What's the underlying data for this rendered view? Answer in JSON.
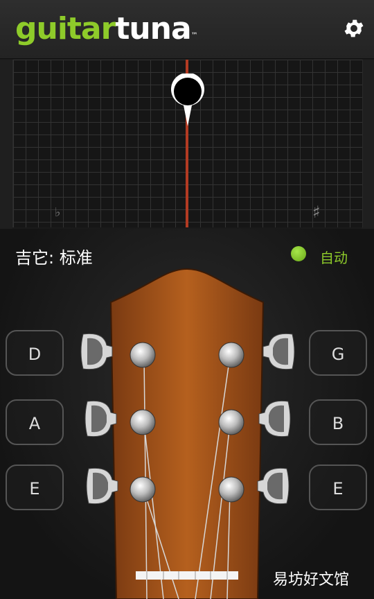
{
  "header": {
    "logo_part1": "guitar",
    "logo_part2": "tuna",
    "logo_tm": "™"
  },
  "tuner": {
    "flat_symbol": "♭",
    "sharp_symbol": "♯"
  },
  "tuning": {
    "name": "吉它: 标准",
    "mode_label": "自动"
  },
  "strings": {
    "left": [
      "D",
      "A",
      "E"
    ],
    "right": [
      "G",
      "B",
      "E"
    ]
  },
  "watermark": "易坊好文馆",
  "colors": {
    "accent": "#8ecb2a",
    "needle": "#b23a22"
  }
}
